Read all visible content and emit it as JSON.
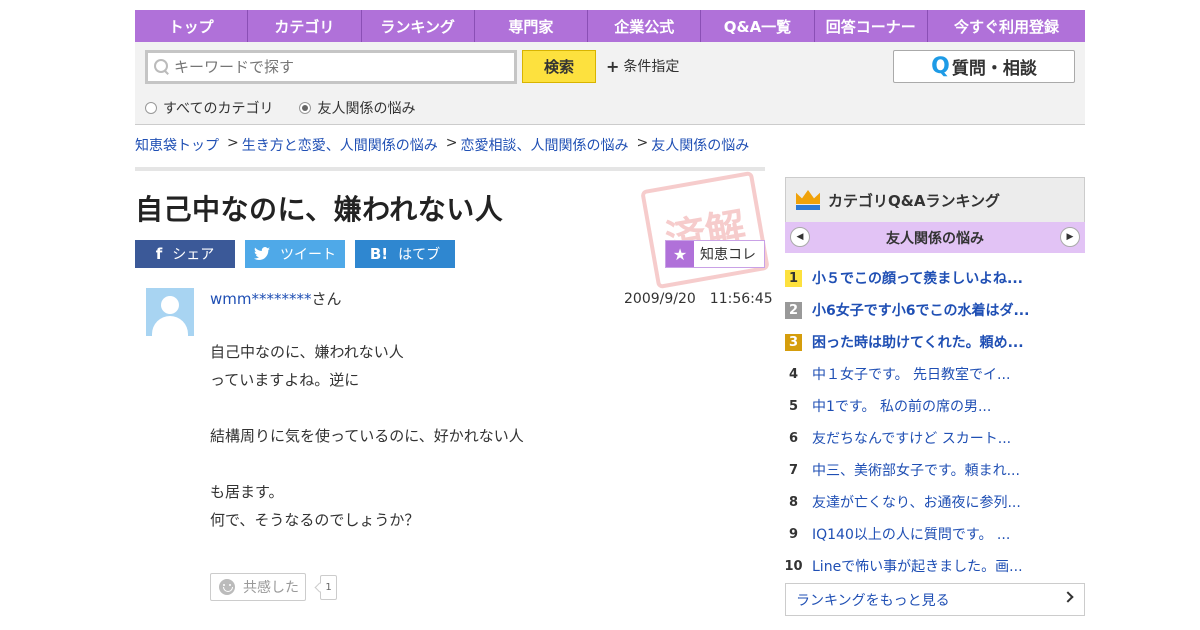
{
  "nav": [
    "トップ",
    "カテゴリ",
    "ランキング",
    "専門家",
    "企業公式",
    "Q&A一覧",
    "回答コーナー",
    "今すぐ利用登録"
  ],
  "search": {
    "placeholder": "キーワードで探す",
    "button": "検索",
    "conditions": "条件指定",
    "ask_button": "質問・相談",
    "scope_all": "すべてのカテゴリ",
    "scope_current": "友人関係の悩み"
  },
  "breadcrumb": [
    "知恵袋トップ",
    "生き方と恋愛、人間関係の悩み",
    "恋愛相談、人間関係の悩み",
    "友人関係の悩み"
  ],
  "question": {
    "title": "自己中なのに、嫌われない人",
    "stamp": "済解",
    "user": "wmm********",
    "user_suffix": "さん",
    "date": "2009/9/20　11:56:45",
    "body": [
      "自己中なのに、嫌われない人",
      "っていますよね。逆に",
      "",
      "結構周りに気を使っているのに、好かれない人",
      "",
      "も居ます。",
      "何で、そうなるのでしょうか？"
    ],
    "empathy_label": "共感した",
    "empathy_count": "1"
  },
  "share": {
    "facebook": "シェア",
    "twitter": "ツイート",
    "hatena": "はてブ",
    "collect": "知恵コレ"
  },
  "sidebar": {
    "title": "カテゴリQ&Aランキング",
    "category": "友人関係の悩み",
    "ranking": [
      {
        "rank": "1",
        "text": "小５でこの顔って羨ましいよね..."
      },
      {
        "rank": "2",
        "text": "小6女子です小6でこの水着はダ..."
      },
      {
        "rank": "3",
        "text": "困った時は助けてくれた。頼め..."
      },
      {
        "rank": "4",
        "text": "中１女子です。 先日教室でイ..."
      },
      {
        "rank": "5",
        "text": "中1です。 私の前の席の男..."
      },
      {
        "rank": "6",
        "text": "友だちなんですけど スカート..."
      },
      {
        "rank": "7",
        "text": "中三、美術部女子です。頼まれ..."
      },
      {
        "rank": "8",
        "text": "友達が亡くなり、お通夜に参列..."
      },
      {
        "rank": "9",
        "text": "IQ140以上の人に質問です。 ..."
      },
      {
        "rank": "10",
        "text": "Lineで怖い事が起きました。画..."
      }
    ],
    "more": "ランキングをもっと見る"
  },
  "colors": {
    "nav": "#b071d9",
    "link": "#1f4fb4",
    "search_button": "#fde13e"
  }
}
